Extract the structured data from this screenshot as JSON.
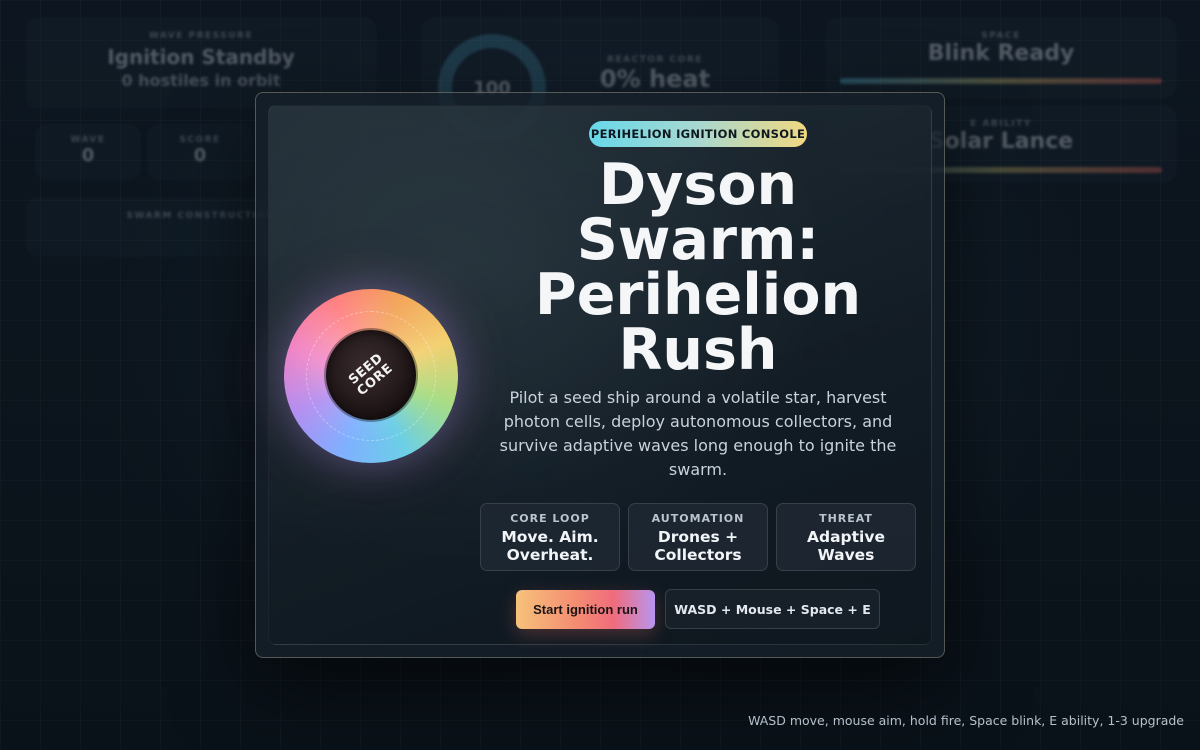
{
  "hud": {
    "wave_pressure": {
      "caption": "WAVE PRESSURE",
      "status": "Ignition Standby",
      "detail": "0 hostiles in orbit"
    },
    "wave": {
      "caption": "WAVE",
      "value": "0"
    },
    "score": {
      "caption": "SCORE",
      "value": "0"
    },
    "swarm": {
      "caption": "SWARM CONSTRUCTION"
    },
    "reactor": {
      "caption": "REACTOR CORE",
      "value": "0% heat",
      "ring_value": "100"
    },
    "space": {
      "caption": "SPACE",
      "value": "Blink Ready",
      "ready_fraction": 1.0
    },
    "e_ability": {
      "caption": "E ABILITY",
      "value": "Solar Lance",
      "ready_fraction": 1.0
    }
  },
  "modal": {
    "badge": "PERIHELION IGNITION CONSOLE",
    "title_lines": [
      "Dyson",
      "Swarm:",
      "Perihelion",
      "Rush"
    ],
    "description": "Pilot a seed ship around a volatile star, harvest photon cells, deploy autonomous collectors, and survive adaptive waves long enough to ignite the swarm.",
    "orb_label_lines": [
      "SEED",
      "CORE"
    ],
    "chips": [
      {
        "key": "CORE LOOP",
        "lines": [
          "Move. Aim.",
          "Overheat."
        ]
      },
      {
        "key": "AUTOMATION",
        "lines": [
          "Drones +",
          "Collectors"
        ]
      },
      {
        "key": "THREAT",
        "lines": [
          "Adaptive",
          "Waves"
        ]
      }
    ],
    "start_button": "Start ignition run",
    "keys_button": "WASD + Mouse + Space + E"
  },
  "footer": {
    "hint": "WASD move, mouse aim, hold fire, Space blink, E ability, 1-3 upgrade"
  },
  "colors": {
    "accent_cyan": "#67d8ea",
    "accent_gold": "#f0d880",
    "accent_coral": "#f48a72",
    "accent_violet": "#b895f0"
  }
}
